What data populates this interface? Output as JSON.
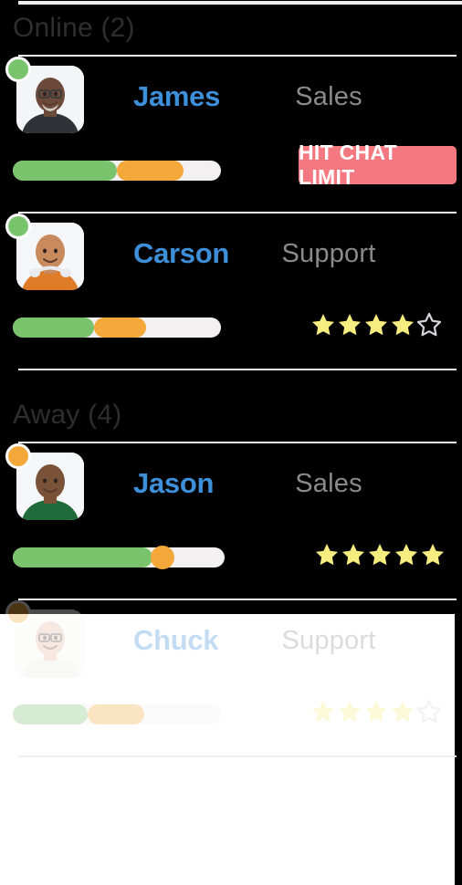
{
  "theme": {
    "name_color": "#3d8fd9",
    "role_color": "#8a8a8a",
    "section_color": "#2e2e2e",
    "online_dot": "#7ac36d",
    "away_dot": "#f5a83a",
    "meter_green": "#7ac36d",
    "meter_orange": "#f5a83a",
    "meter_track": "#f2f0f0",
    "badge_bg": "#f4787f",
    "star_filled": "#f7ec7f",
    "star_empty": "#d8d4d8",
    "panel_bg": "#ffffff",
    "background": "#000000"
  },
  "sections": [
    {
      "id": "online",
      "title": "Online (2)",
      "status": "online",
      "count": 2,
      "agents": [
        {
          "name": "James",
          "role": "Sales",
          "status": "online",
          "avatar_alt": "james-avatar",
          "meter": {
            "green_pct": 50,
            "orange_pct": 32,
            "style": "two-segment"
          },
          "indicator": {
            "type": "badge",
            "label": "HIT CHAT LIMIT"
          },
          "faded": false
        },
        {
          "name": "Carson",
          "role": "Support",
          "status": "online",
          "avatar_alt": "carson-avatar",
          "meter": {
            "green_pct": 39,
            "orange_pct": 25,
            "style": "two-segment"
          },
          "indicator": {
            "type": "rating",
            "filled": 4,
            "total": 5
          },
          "faded": false
        }
      ]
    },
    {
      "id": "away",
      "title": "Away (4)",
      "status": "away",
      "count": 4,
      "agents": [
        {
          "name": "Jason",
          "role": "Sales",
          "status": "away",
          "avatar_alt": "jason-avatar",
          "meter": {
            "green_pct": 66,
            "orange_pct": 0,
            "style": "knob"
          },
          "indicator": {
            "type": "rating",
            "filled": 5,
            "total": 5
          },
          "faded": false
        },
        {
          "name": "Chuck",
          "role": "Support",
          "status": "away",
          "avatar_alt": "chuck-avatar",
          "meter": {
            "green_pct": 36,
            "orange_pct": 27,
            "style": "two-segment"
          },
          "indicator": {
            "type": "rating",
            "filled": 4,
            "total": 5
          },
          "faded": true
        }
      ]
    }
  ]
}
